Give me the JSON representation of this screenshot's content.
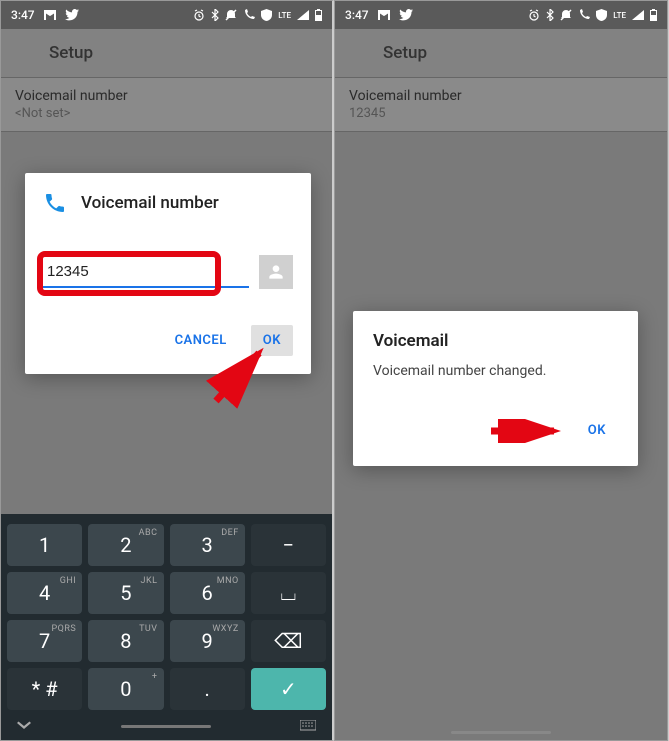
{
  "status": {
    "time": "3:47",
    "icons": [
      "gmail-icon",
      "twitter-icon",
      "alarm-icon",
      "bluetooth-icon",
      "dnd-icon",
      "wifi-calling-icon",
      "shield-icon",
      "lte-label",
      "signal-icon",
      "battery-icon"
    ],
    "lte": "LTE"
  },
  "header": {
    "title": "Setup"
  },
  "left": {
    "setting_title": "Voicemail number",
    "setting_value": "<Not set>",
    "dialog": {
      "title": "Voicemail number",
      "input_value": "12345",
      "cancel": "CANCEL",
      "ok": "OK"
    }
  },
  "right": {
    "setting_title": "Voicemail number",
    "setting_value": "12345",
    "dialog": {
      "title": "Voicemail",
      "message": "Voicemail number changed.",
      "ok": "OK"
    }
  },
  "keyboard": {
    "rows": [
      [
        {
          "d": "1",
          "s": ""
        },
        {
          "d": "2",
          "s": "ABC"
        },
        {
          "d": "3",
          "s": "DEF"
        },
        {
          "d": "−",
          "s": "",
          "dark": true
        }
      ],
      [
        {
          "d": "4",
          "s": "GHI"
        },
        {
          "d": "5",
          "s": "JKL"
        },
        {
          "d": "6",
          "s": "MNO"
        },
        {
          "d": "⌴",
          "s": "",
          "dark": true
        }
      ],
      [
        {
          "d": "7",
          "s": "PQRS"
        },
        {
          "d": "8",
          "s": "TUV"
        },
        {
          "d": "9",
          "s": "WXYZ"
        },
        {
          "d": "⌫",
          "s": "",
          "dark": true
        }
      ],
      [
        {
          "d": "* #",
          "s": "",
          "dark": true
        },
        {
          "d": "0",
          "s": "+"
        },
        {
          "d": ".",
          "s": "",
          "dark": true
        },
        {
          "d": "✓",
          "s": "",
          "accent": true
        }
      ]
    ]
  },
  "annotations": {
    "left_arrow_target": "ok-button",
    "right_arrow_target": "ok-button"
  }
}
